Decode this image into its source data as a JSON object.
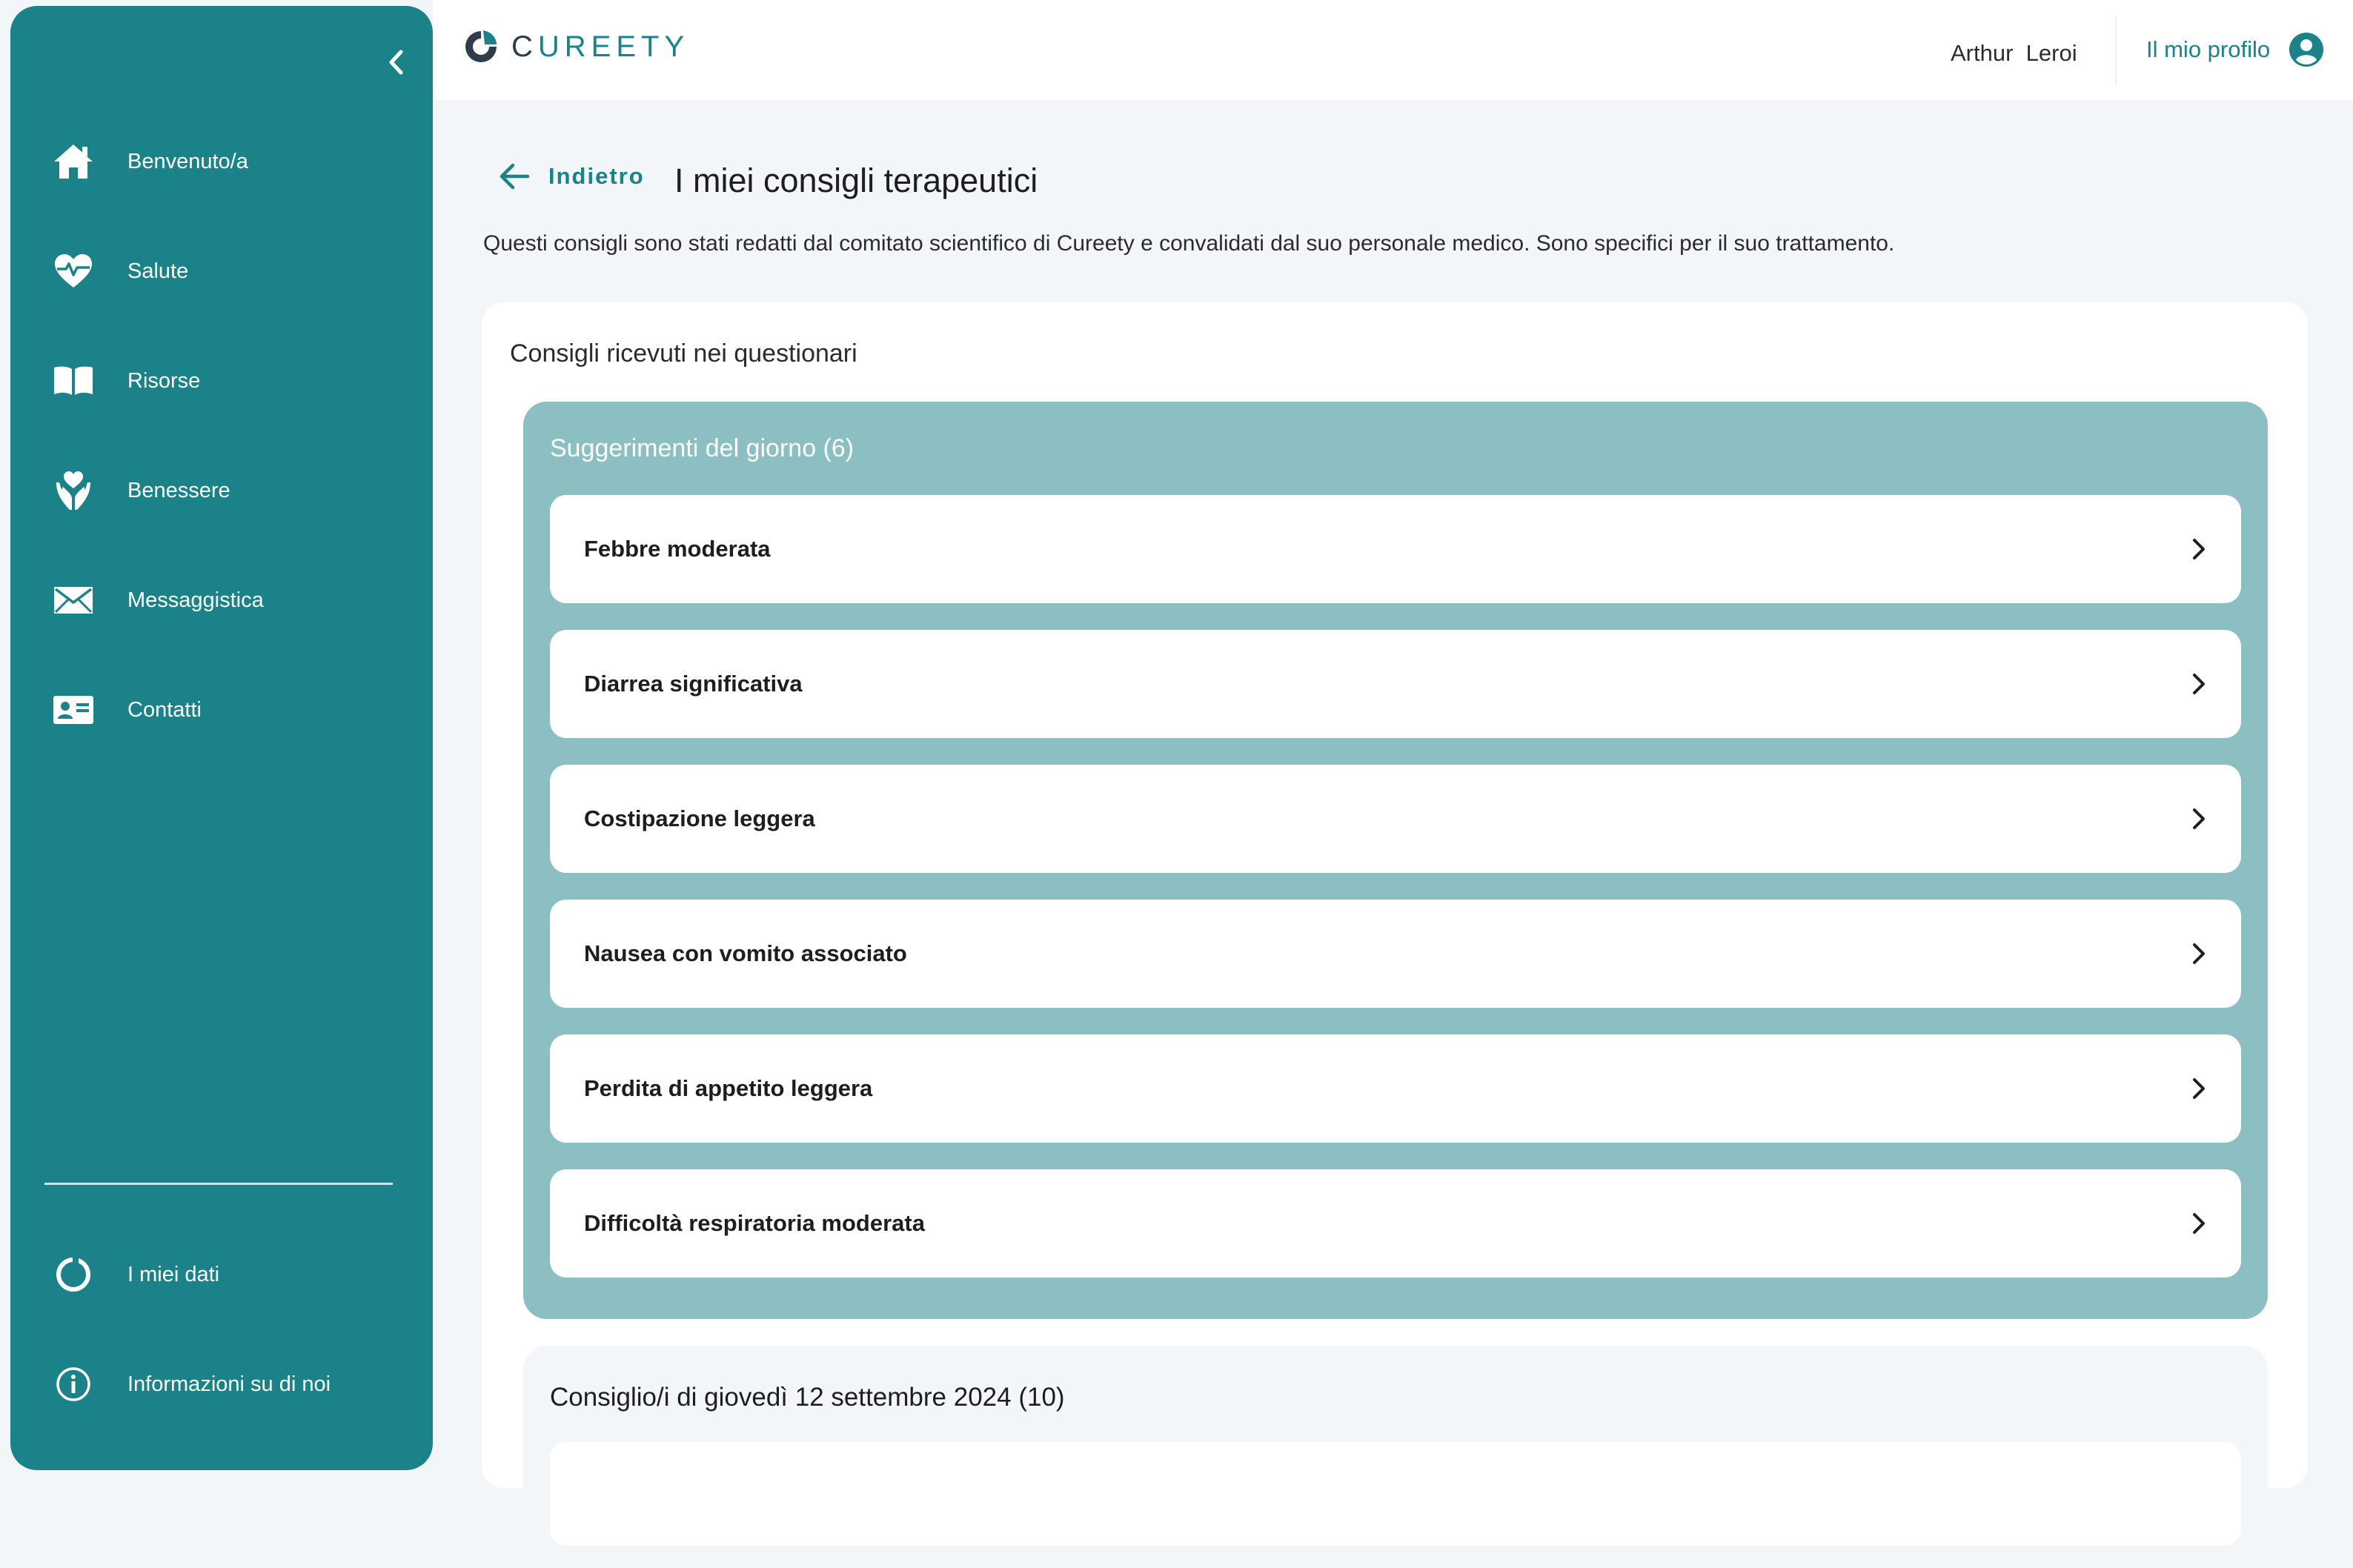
{
  "brand": {
    "name_prefix": "C",
    "name_rest": "UREETY"
  },
  "sidebar": {
    "items": [
      {
        "label": "Benvenuto/a",
        "icon": "home-icon"
      },
      {
        "label": "Salute",
        "icon": "heart-pulse-icon"
      },
      {
        "label": "Risorse",
        "icon": "book-icon"
      },
      {
        "label": "Benessere",
        "icon": "hands-heart-icon"
      },
      {
        "label": "Messaggistica",
        "icon": "envelope-icon"
      },
      {
        "label": "Contatti",
        "icon": "contact-card-icon"
      }
    ],
    "bottom_items": [
      {
        "label": "I miei dati",
        "icon": "donut-chart-icon"
      },
      {
        "label": "Informazioni su di noi",
        "icon": "info-icon"
      }
    ]
  },
  "topbar": {
    "user_name": "Arthur  Leroi",
    "profile_label": "Il mio profilo"
  },
  "main": {
    "back_label": "Indietro",
    "title": "I miei consigli terapeutici",
    "description": "Questi consigli sono stati redatti dal comitato scientifico di Cureety e convalidati dal suo personale medico. Sono specifici per il suo trattamento.",
    "card_title": "Consigli ricevuti nei questionari",
    "today": {
      "title": "Suggerimenti del giorno (6)",
      "items": [
        "Febbre moderata",
        "Diarrea significativa",
        "Costipazione leggera",
        "Nausea con vomito associato",
        "Perdita di appetito leggera",
        "Difficoltà respiratoria moderata"
      ]
    },
    "dated": {
      "title": "Consiglio/i di giovedì 12 settembre 2024 (10)"
    }
  },
  "colors": {
    "primary": "#1a8288",
    "group_bg": "#8bbfc1",
    "page_bg": "#f2f6f8"
  }
}
